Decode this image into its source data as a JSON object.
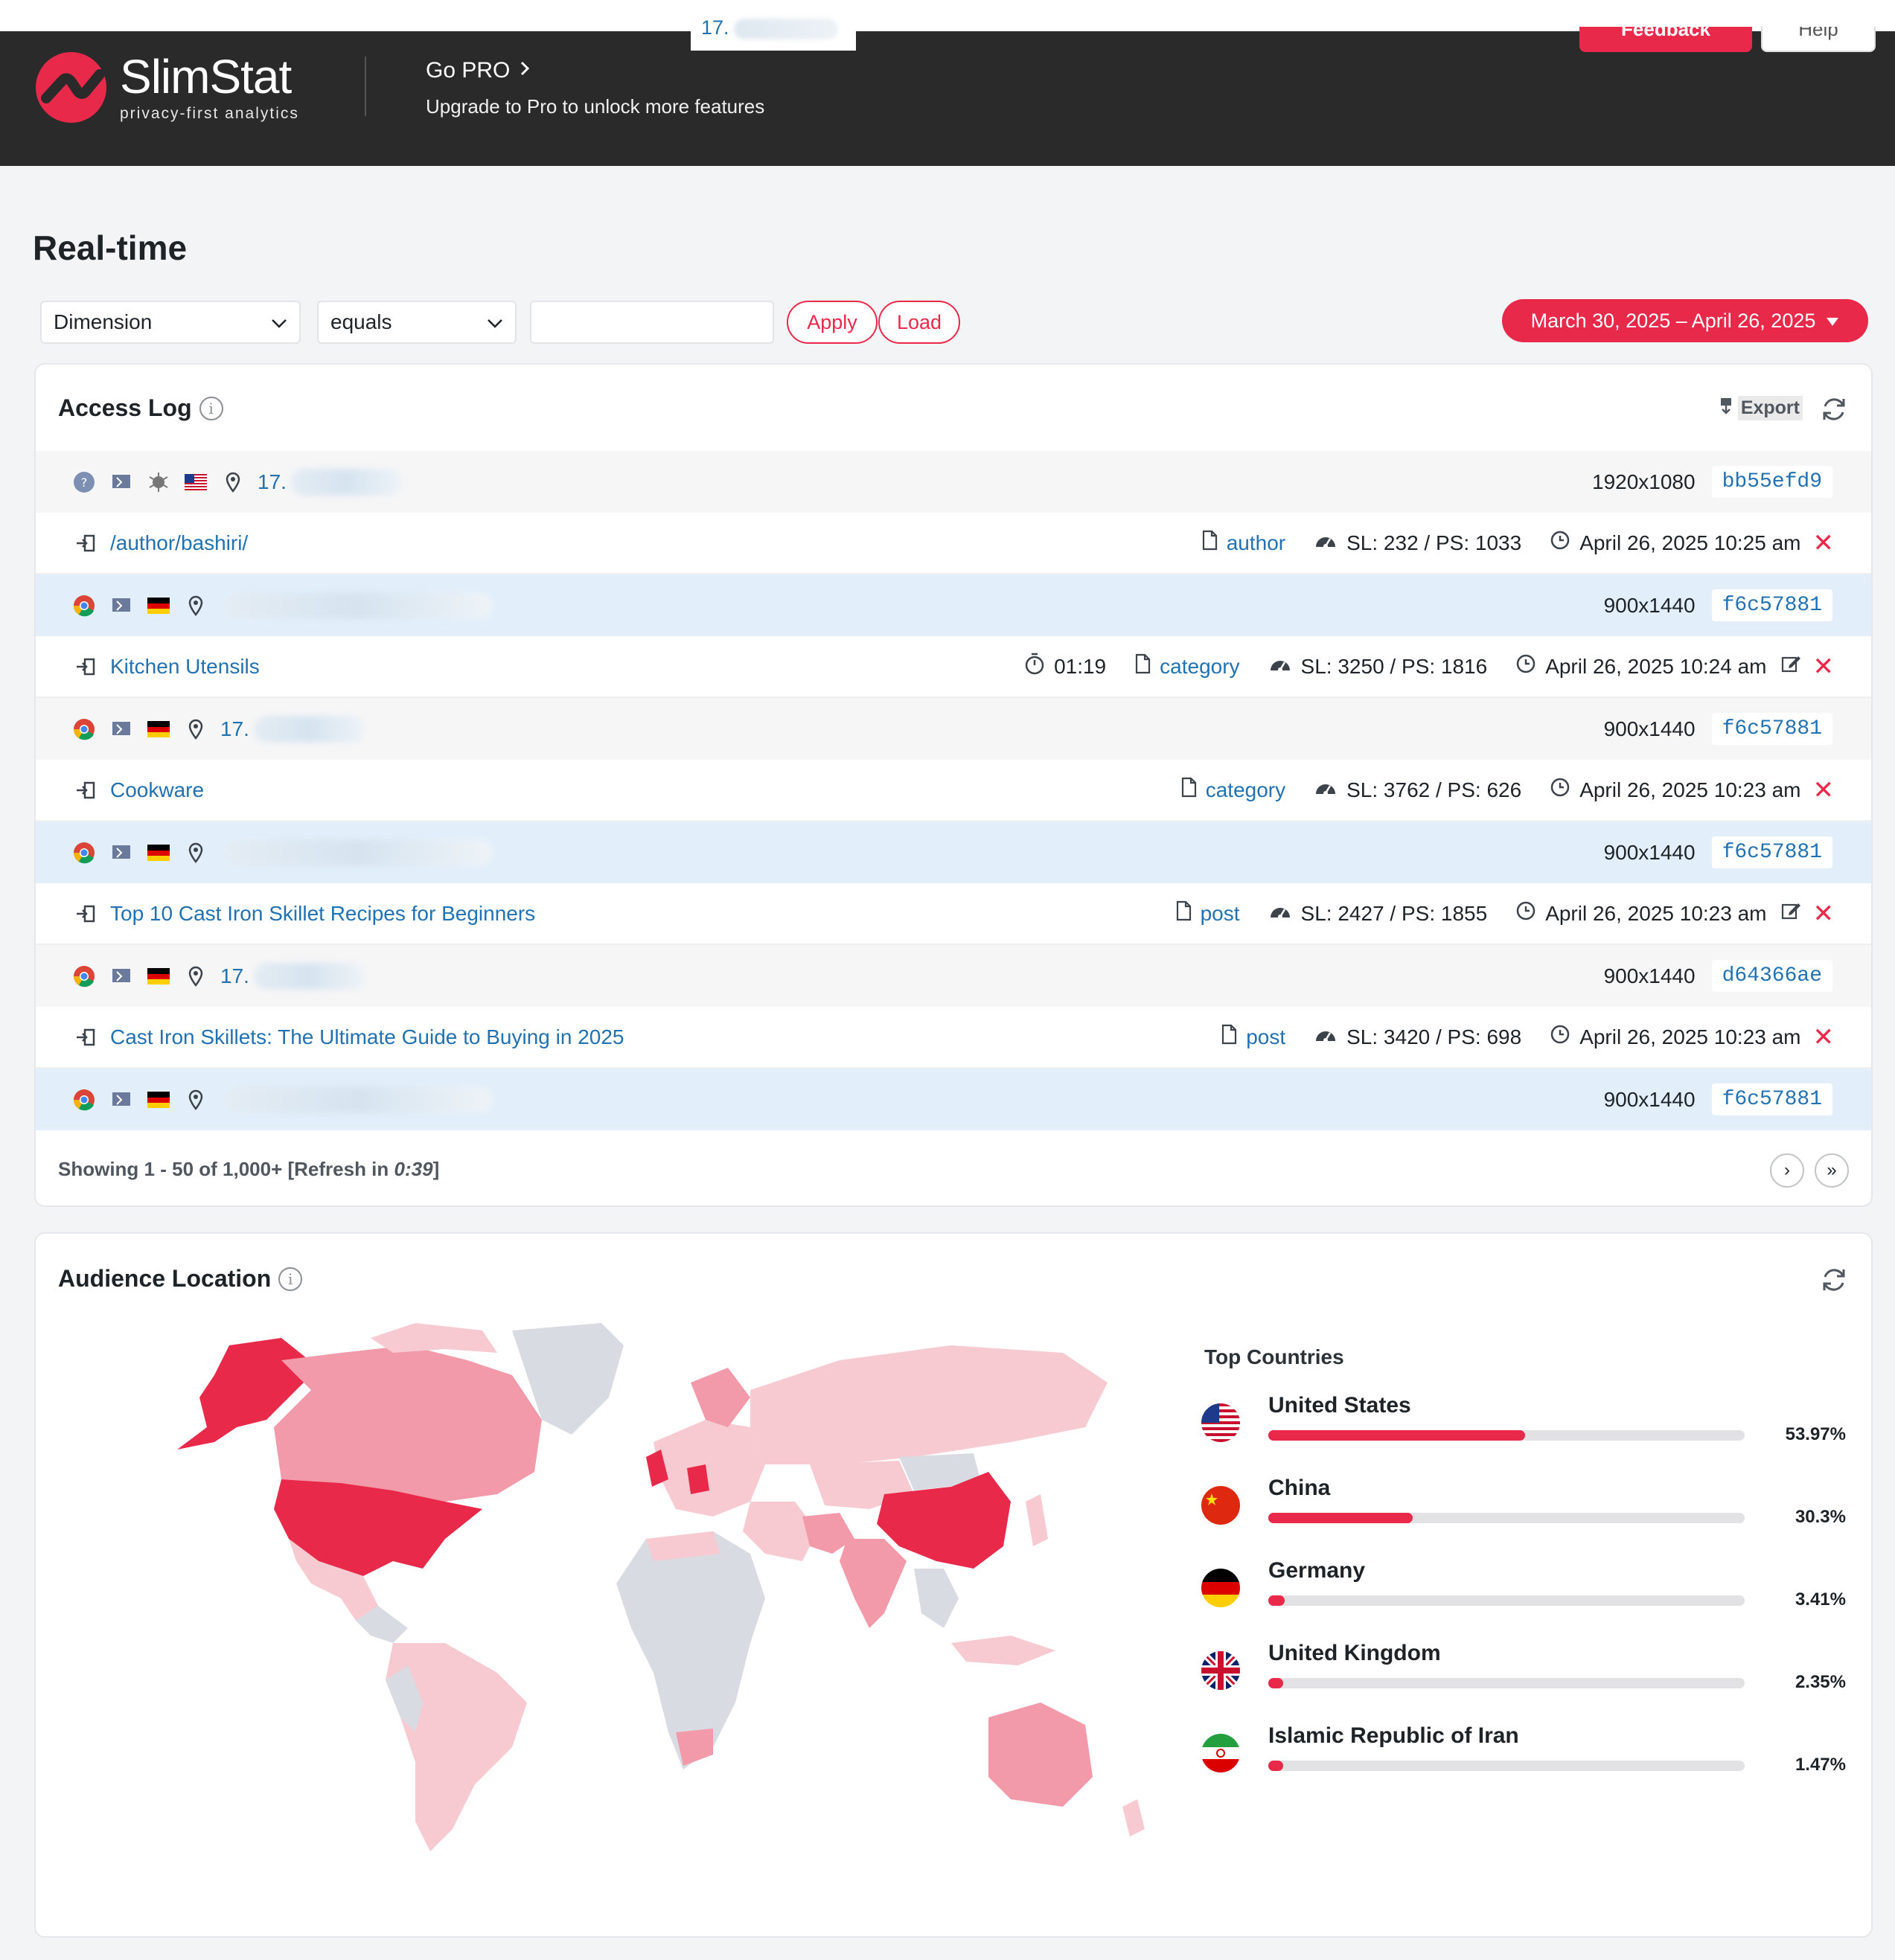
{
  "header": {
    "tab_text": "17.",
    "logo_name": "SlimStat",
    "logo_tagline": "privacy-first analytics",
    "gopro_title": "Go PRO",
    "gopro_subtitle": "Upgrade to Pro to unlock more features",
    "feedback_label": "Feedback",
    "help_label": "Help"
  },
  "page": {
    "title": "Real-time"
  },
  "filters": {
    "dimension": "Dimension",
    "operator": "equals",
    "value_placeholder": "",
    "apply_label": "Apply",
    "load_label": "Load",
    "date_range": "March 30, 2025 – April 26, 2025"
  },
  "access_log": {
    "title": "Access Log",
    "export_label": "Export",
    "rows": [
      {
        "kind": "visitor",
        "ip": "17.",
        "resolution": "1920x1080",
        "hash": "bb55efd9",
        "highlight": false,
        "flag": "us"
      },
      {
        "kind": "page",
        "url": "/author/bashiri/",
        "type": "author",
        "stats": "SL: 232 / PS: 1033",
        "date": "April 26, 2025 10:25 am",
        "duration": "",
        "edit": false
      },
      {
        "kind": "visitor",
        "ip": "",
        "resolution": "900x1440",
        "hash": "f6c57881",
        "highlight": true,
        "flag": "de"
      },
      {
        "kind": "page",
        "url": "Kitchen Utensils",
        "type": "category",
        "stats": "SL: 3250 / PS: 1816",
        "date": "April 26, 2025 10:24 am",
        "duration": "01:19",
        "edit": true
      },
      {
        "kind": "visitor",
        "ip": "17.",
        "resolution": "900x1440",
        "hash": "f6c57881",
        "highlight": false,
        "flag": "de"
      },
      {
        "kind": "page",
        "url": "Cookware",
        "type": "category",
        "stats": "SL: 3762 / PS: 626",
        "date": "April 26, 2025 10:23 am",
        "duration": "",
        "edit": false
      },
      {
        "kind": "visitor",
        "ip": "",
        "resolution": "900x1440",
        "hash": "f6c57881",
        "highlight": true,
        "flag": "de"
      },
      {
        "kind": "page",
        "url": "Top 10 Cast Iron Skillet Recipes for Beginners",
        "type": "post",
        "stats": "SL: 2427 / PS: 1855",
        "date": "April 26, 2025 10:23 am",
        "duration": "",
        "edit": true
      },
      {
        "kind": "visitor",
        "ip": "17.",
        "resolution": "900x1440",
        "hash": "d64366ae",
        "highlight": false,
        "flag": "de"
      },
      {
        "kind": "page",
        "url": "Cast Iron Skillets: The Ultimate Guide to Buying in 2025",
        "type": "post",
        "stats": "SL: 3420 / PS: 698",
        "date": "April 26, 2025 10:23 am",
        "duration": "",
        "edit": false
      },
      {
        "kind": "visitor",
        "ip": "",
        "resolution": "900x1440",
        "hash": "f6c57881",
        "highlight": true,
        "flag": "de"
      }
    ],
    "footer_prefix": "Showing 1 - 50 of 1,000+ [Refresh in ",
    "footer_time": "0:39",
    "footer_suffix": "]"
  },
  "audience": {
    "title": "Audience Location",
    "top_countries_title": "Top Countries",
    "countries": [
      {
        "name": "United States",
        "pct": "53.97%",
        "share": 53.97,
        "flag": "us"
      },
      {
        "name": "China",
        "pct": "30.3%",
        "share": 30.3,
        "flag": "cn"
      },
      {
        "name": "Germany",
        "pct": "3.41%",
        "share": 3.41,
        "flag": "de"
      },
      {
        "name": "United Kingdom",
        "pct": "2.35%",
        "share": 2.35,
        "flag": "gb"
      },
      {
        "name": "Islamic Republic of Iran",
        "pct": "1.47%",
        "share": 1.47,
        "flag": "ir"
      }
    ]
  },
  "colors": {
    "brand": "#e8294a",
    "link": "#2271b1",
    "header_bg": "#2a2a2b",
    "map_high": "#e8294a",
    "map_mid": "#f29aa9",
    "map_low": "#f7c9d1",
    "map_none": "#d9dbe3"
  }
}
